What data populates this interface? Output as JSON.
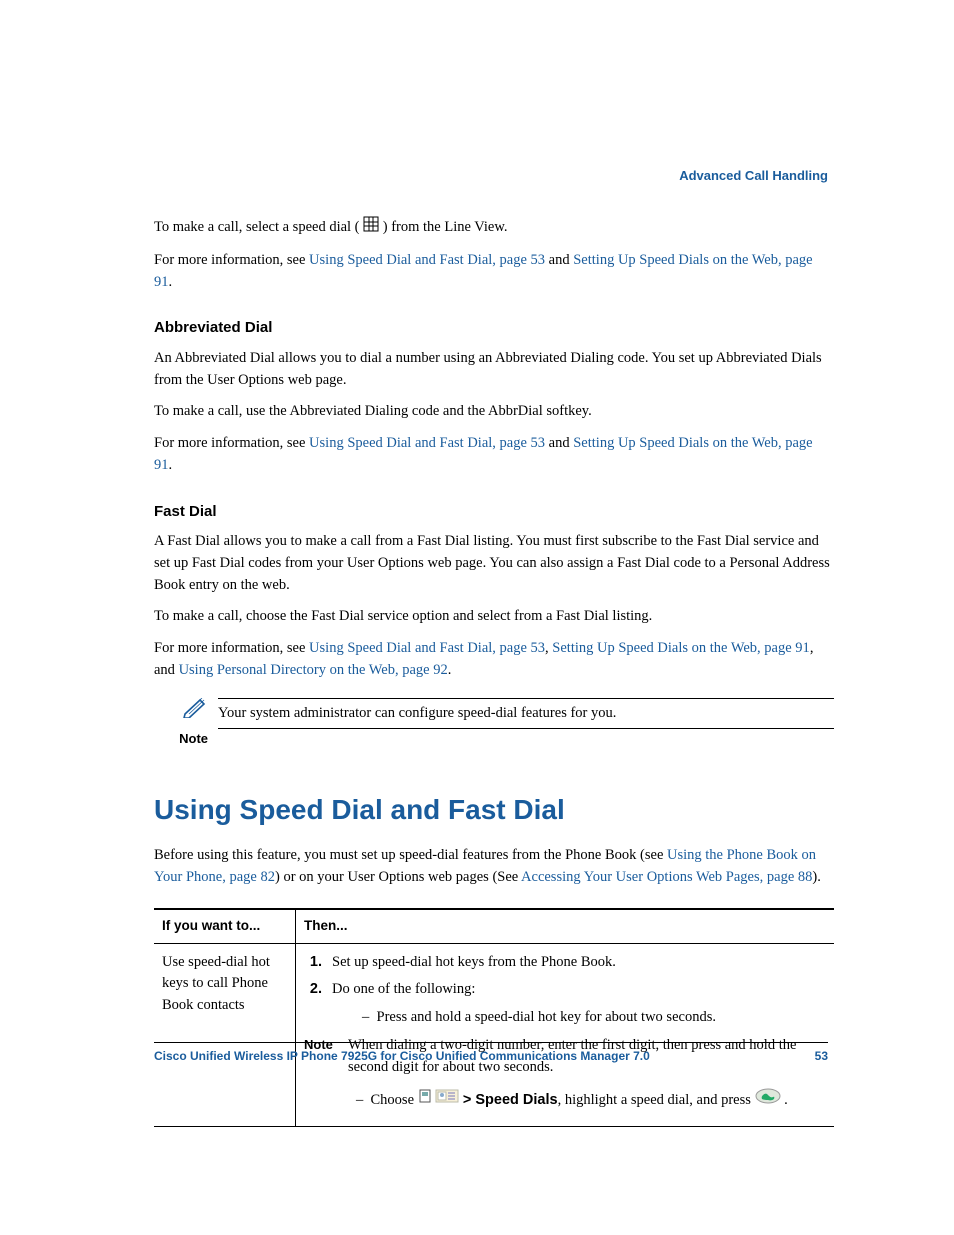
{
  "header": {
    "chapter": "Advanced Call Handling"
  },
  "intro": {
    "p1a": "To make a call, select a speed dial (",
    "p1b": ") from the Line View.",
    "p2a": "For more information, see ",
    "link1": "Using Speed Dial and Fast Dial, page 53",
    "p2b": " and ",
    "link2": "Setting Up Speed Dials on the Web, page 91",
    "p2c": "."
  },
  "abbr": {
    "heading": "Abbreviated Dial",
    "p1": "An Abbreviated Dial allows you to dial a number using an Abbreviated Dialing code. You set up Abbreviated Dials from the User Options web page.",
    "p2": "To make a call, use the Abbreviated Dialing code and the AbbrDial softkey.",
    "p3a": "For more information, see ",
    "link1": "Using Speed Dial and Fast Dial, page 53",
    "p3b": " and ",
    "link2": "Setting Up Speed Dials on the Web, page 91",
    "p3c": "."
  },
  "fast": {
    "heading": "Fast Dial",
    "p1": "A Fast Dial allows you to make a call from a Fast Dial listing. You must first subscribe to the Fast Dial service and set up Fast Dial codes from your User Options web page. You can also assign a Fast Dial code to a Personal Address Book entry on the web.",
    "p2": "To make a call, choose the Fast Dial service option and select from a Fast Dial listing.",
    "p3a": "For more information, see ",
    "link1": "Using Speed Dial and Fast Dial, page 53",
    "p3b": ", ",
    "link2": "Setting Up Speed Dials on the Web, page 91",
    "p3c": ", and ",
    "link3": "Using Personal Directory on the Web, page 92",
    "p3d": "."
  },
  "note1": {
    "label": "Note",
    "text": "Your system administrator can configure speed-dial features for you."
  },
  "section": {
    "title": "Using Speed Dial and Fast Dial",
    "p1a": "Before using this feature, you must set up speed-dial features from the Phone Book (see ",
    "link1": "Using the Phone Book on Your Phone, page 82",
    "p1b": ") or on your User Options web pages (See ",
    "link2": "Accessing Your User Options Web Pages, page 88",
    "p1c": ")."
  },
  "table": {
    "h1": "If you want to...",
    "h2": "Then...",
    "row1": {
      "c1": "Use speed-dial hot keys to call Phone Book contacts",
      "s1": "Set up speed-dial hot keys from the Phone Book.",
      "s2": "Do one of the following:",
      "d1": "Press and hold a speed-dial hot key for about two seconds.",
      "noteLabel": "Note",
      "noteText": "When dialing a two-digit number, enter the first digit, then press and hold the second digit for about two seconds.",
      "d2a": "Choose ",
      "d2b": " > Speed Dials",
      "d2c": ", highlight a speed dial, and press ",
      "d2d": "."
    }
  },
  "footer": {
    "title": "Cisco Unified Wireless IP Phone 7925G for Cisco Unified Communications Manager 7.0",
    "page": "53"
  }
}
